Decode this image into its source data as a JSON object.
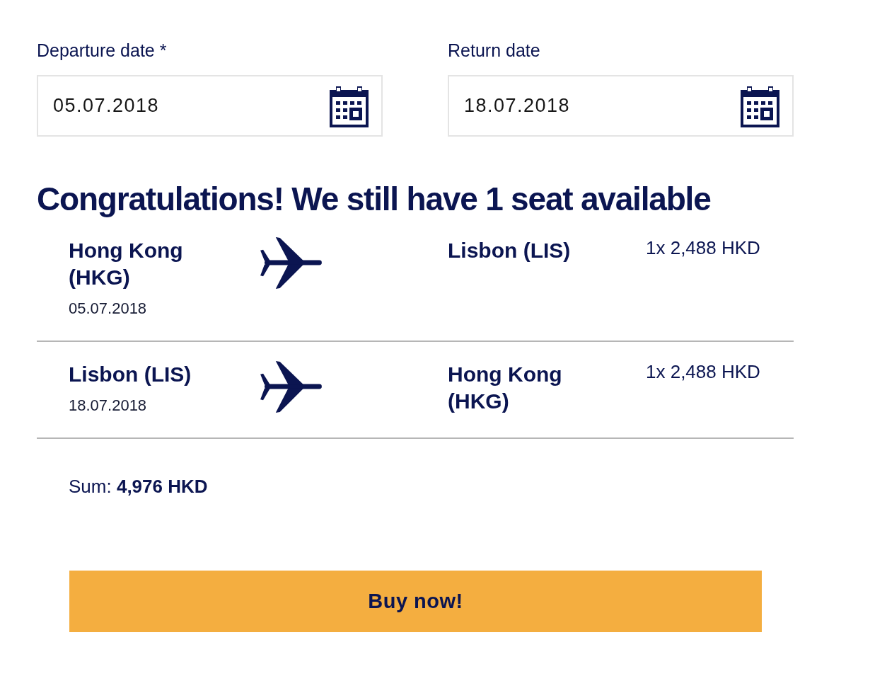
{
  "date_fields": [
    {
      "label": "Departure date *",
      "value": "05.07.2018"
    },
    {
      "label": "Return date",
      "value": "18.07.2018"
    }
  ],
  "heading": "Congratulations! We still have 1 seat available",
  "flights": [
    {
      "origin": "Hong Kong (HKG)",
      "date": "05.07.2018",
      "destination": "Lisbon (LIS)",
      "price": "1x 2,488 HKD"
    },
    {
      "origin": "Lisbon (LIS)",
      "date": "18.07.2018",
      "destination": "Hong Kong (HKG)",
      "price": "1x 2,488 HKD"
    }
  ],
  "sum": "Sum: **4,976 HKD**",
  "buy_button": "Buy now!"
}
